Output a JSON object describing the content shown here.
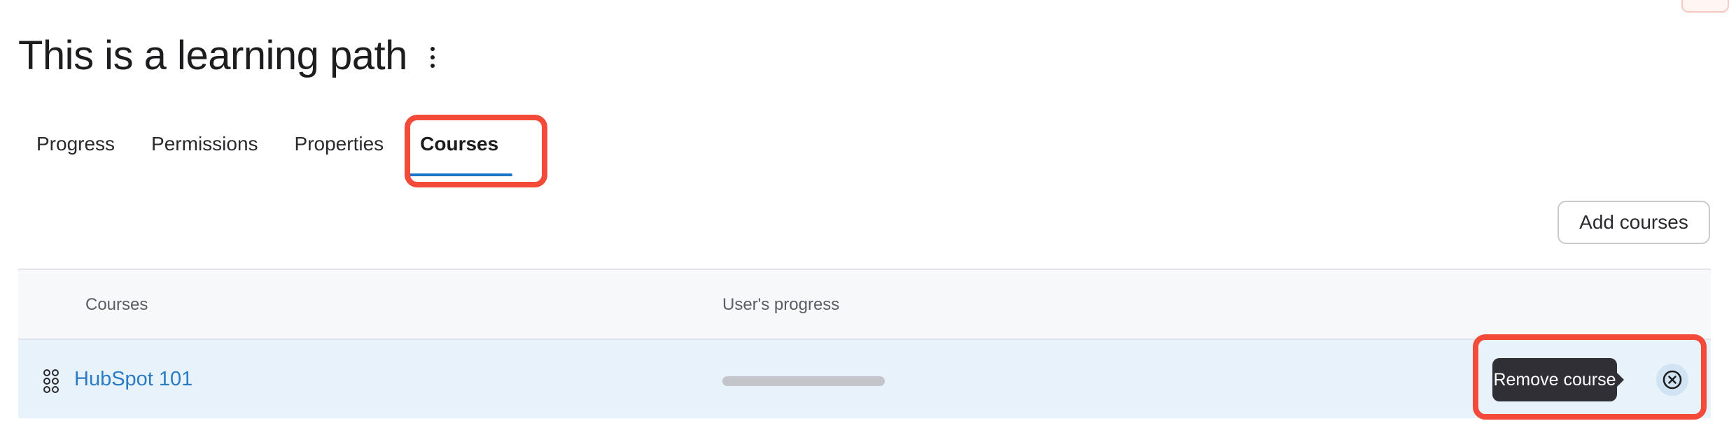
{
  "page": {
    "title": "This is a learning path"
  },
  "tabs": [
    {
      "label": "Progress",
      "active": false
    },
    {
      "label": "Permissions",
      "active": false
    },
    {
      "label": "Properties",
      "active": false
    },
    {
      "label": "Courses",
      "active": true
    }
  ],
  "toolbar": {
    "add_courses_label": "Add courses"
  },
  "table": {
    "columns": [
      "Courses",
      "User's progress"
    ],
    "rows": [
      {
        "course": "HubSpot 101",
        "progress_fraction": 0,
        "tooltip": "Remove course"
      }
    ]
  },
  "icons": {
    "kebab": "more-vertical-icon",
    "drag": "drag-handle-icon",
    "remove": "close-circle-icon"
  },
  "colors": {
    "accent": "#1c74c6",
    "link": "#2b7bc4",
    "highlight": "#f34a3a",
    "row_background": "#e8f2fb",
    "tooltip_background": "#2f2f35"
  }
}
